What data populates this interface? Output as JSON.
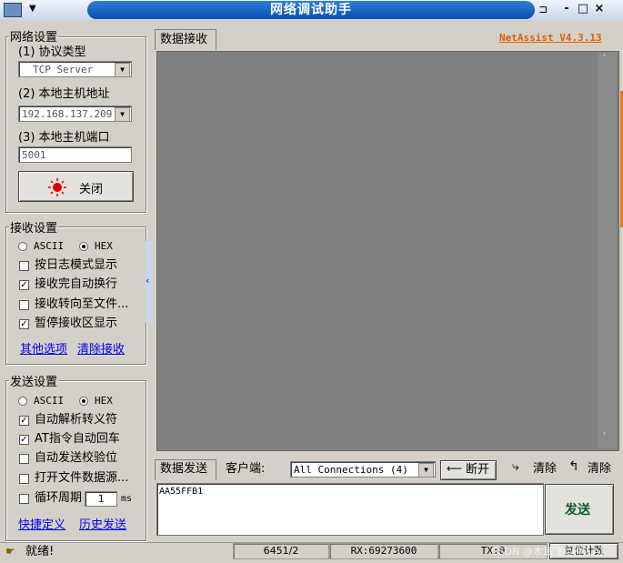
{
  "window": {
    "title": "网络调试助手",
    "minimize": "-",
    "maximize": "□",
    "close": "×"
  },
  "brand": "NetAssist V4.3.13",
  "network": {
    "group_label": "网络设置",
    "protocol_label": "(1) 协议类型",
    "protocol_value": "TCP Server",
    "host_label": "(2) 本地主机地址",
    "host_value": "192.168.137.209",
    "port_label": "(3) 本地主机端口",
    "port_value": "5001",
    "close_button": "关闭"
  },
  "receive": {
    "group_label": "接收设置",
    "ascii": "ASCII",
    "hex": "HEX",
    "mode": "HEX",
    "options": [
      {
        "label": "按日志模式显示",
        "checked": false
      },
      {
        "label": "接收完自动换行",
        "checked": true
      },
      {
        "label": "接收转向至文件...",
        "checked": false
      },
      {
        "label": "暂停接收区显示",
        "checked": true
      }
    ],
    "more_options": "其他选项",
    "clear_receive": "清除接收"
  },
  "send": {
    "group_label": "发送设置",
    "ascii": "ASCII",
    "hex": "HEX",
    "mode": "HEX",
    "options": [
      {
        "label": "自动解析转义符",
        "checked": true
      },
      {
        "label": "AT指令自动回车",
        "checked": true
      },
      {
        "label": "自动发送校验位",
        "checked": false
      },
      {
        "label": "打开文件数据源...",
        "checked": false
      }
    ],
    "cycle_label": "循环周期",
    "cycle_value": "1",
    "cycle_unit": "ms",
    "cycle_checked": false,
    "shortcut": "快捷定义",
    "history": "历史发送"
  },
  "receive_tab": "数据接收",
  "send_tab": "数据发送",
  "client_label": "客户端:",
  "client_select": "All Connections (4)",
  "disconnect": "断开",
  "clear1": "清除",
  "clear2": "清除",
  "send_text": "AA55FFB1",
  "send_button": "发送",
  "status": {
    "ready": "就绪!",
    "counter": "6451/2",
    "rx": "RX:69273600",
    "tx": "TX:0",
    "reset": "复位计数"
  },
  "watermark": "CSDN @木耳飞菜种人AT"
}
